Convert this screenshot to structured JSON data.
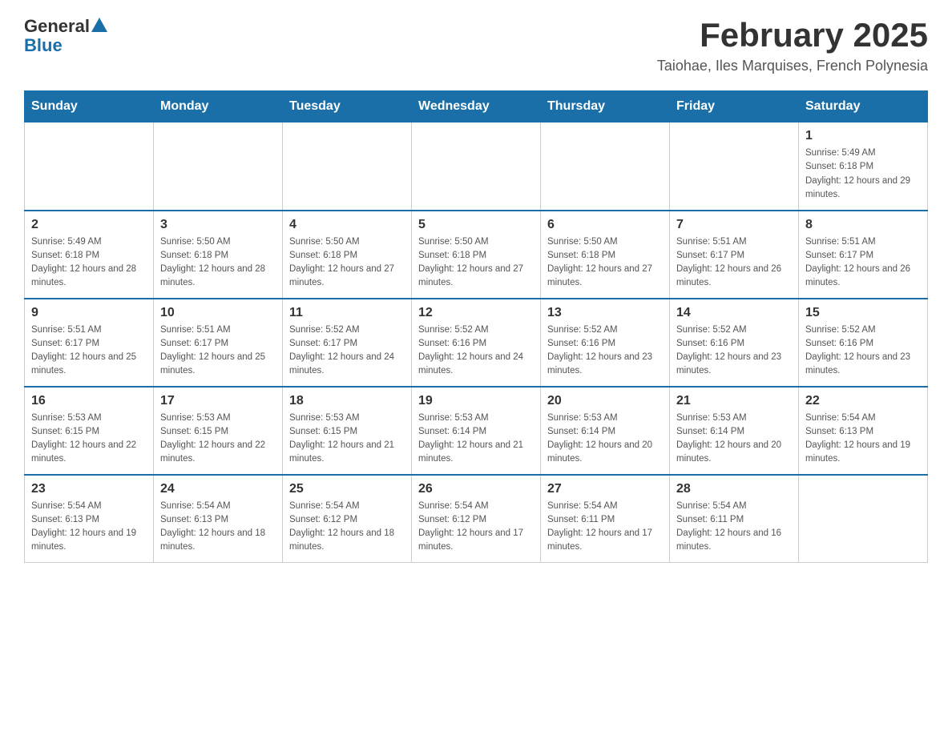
{
  "logo": {
    "general": "General",
    "blue": "Blue"
  },
  "title": "February 2025",
  "location": "Taiohae, Iles Marquises, French Polynesia",
  "days_of_week": [
    "Sunday",
    "Monday",
    "Tuesday",
    "Wednesday",
    "Thursday",
    "Friday",
    "Saturday"
  ],
  "weeks": [
    [
      {
        "day": "",
        "sunrise": "",
        "sunset": "",
        "daylight": ""
      },
      {
        "day": "",
        "sunrise": "",
        "sunset": "",
        "daylight": ""
      },
      {
        "day": "",
        "sunrise": "",
        "sunset": "",
        "daylight": ""
      },
      {
        "day": "",
        "sunrise": "",
        "sunset": "",
        "daylight": ""
      },
      {
        "day": "",
        "sunrise": "",
        "sunset": "",
        "daylight": ""
      },
      {
        "day": "",
        "sunrise": "",
        "sunset": "",
        "daylight": ""
      },
      {
        "day": "1",
        "sunrise": "Sunrise: 5:49 AM",
        "sunset": "Sunset: 6:18 PM",
        "daylight": "Daylight: 12 hours and 29 minutes."
      }
    ],
    [
      {
        "day": "2",
        "sunrise": "Sunrise: 5:49 AM",
        "sunset": "Sunset: 6:18 PM",
        "daylight": "Daylight: 12 hours and 28 minutes."
      },
      {
        "day": "3",
        "sunrise": "Sunrise: 5:50 AM",
        "sunset": "Sunset: 6:18 PM",
        "daylight": "Daylight: 12 hours and 28 minutes."
      },
      {
        "day": "4",
        "sunrise": "Sunrise: 5:50 AM",
        "sunset": "Sunset: 6:18 PM",
        "daylight": "Daylight: 12 hours and 27 minutes."
      },
      {
        "day": "5",
        "sunrise": "Sunrise: 5:50 AM",
        "sunset": "Sunset: 6:18 PM",
        "daylight": "Daylight: 12 hours and 27 minutes."
      },
      {
        "day": "6",
        "sunrise": "Sunrise: 5:50 AM",
        "sunset": "Sunset: 6:18 PM",
        "daylight": "Daylight: 12 hours and 27 minutes."
      },
      {
        "day": "7",
        "sunrise": "Sunrise: 5:51 AM",
        "sunset": "Sunset: 6:17 PM",
        "daylight": "Daylight: 12 hours and 26 minutes."
      },
      {
        "day": "8",
        "sunrise": "Sunrise: 5:51 AM",
        "sunset": "Sunset: 6:17 PM",
        "daylight": "Daylight: 12 hours and 26 minutes."
      }
    ],
    [
      {
        "day": "9",
        "sunrise": "Sunrise: 5:51 AM",
        "sunset": "Sunset: 6:17 PM",
        "daylight": "Daylight: 12 hours and 25 minutes."
      },
      {
        "day": "10",
        "sunrise": "Sunrise: 5:51 AM",
        "sunset": "Sunset: 6:17 PM",
        "daylight": "Daylight: 12 hours and 25 minutes."
      },
      {
        "day": "11",
        "sunrise": "Sunrise: 5:52 AM",
        "sunset": "Sunset: 6:17 PM",
        "daylight": "Daylight: 12 hours and 24 minutes."
      },
      {
        "day": "12",
        "sunrise": "Sunrise: 5:52 AM",
        "sunset": "Sunset: 6:16 PM",
        "daylight": "Daylight: 12 hours and 24 minutes."
      },
      {
        "day": "13",
        "sunrise": "Sunrise: 5:52 AM",
        "sunset": "Sunset: 6:16 PM",
        "daylight": "Daylight: 12 hours and 23 minutes."
      },
      {
        "day": "14",
        "sunrise": "Sunrise: 5:52 AM",
        "sunset": "Sunset: 6:16 PM",
        "daylight": "Daylight: 12 hours and 23 minutes."
      },
      {
        "day": "15",
        "sunrise": "Sunrise: 5:52 AM",
        "sunset": "Sunset: 6:16 PM",
        "daylight": "Daylight: 12 hours and 23 minutes."
      }
    ],
    [
      {
        "day": "16",
        "sunrise": "Sunrise: 5:53 AM",
        "sunset": "Sunset: 6:15 PM",
        "daylight": "Daylight: 12 hours and 22 minutes."
      },
      {
        "day": "17",
        "sunrise": "Sunrise: 5:53 AM",
        "sunset": "Sunset: 6:15 PM",
        "daylight": "Daylight: 12 hours and 22 minutes."
      },
      {
        "day": "18",
        "sunrise": "Sunrise: 5:53 AM",
        "sunset": "Sunset: 6:15 PM",
        "daylight": "Daylight: 12 hours and 21 minutes."
      },
      {
        "day": "19",
        "sunrise": "Sunrise: 5:53 AM",
        "sunset": "Sunset: 6:14 PM",
        "daylight": "Daylight: 12 hours and 21 minutes."
      },
      {
        "day": "20",
        "sunrise": "Sunrise: 5:53 AM",
        "sunset": "Sunset: 6:14 PM",
        "daylight": "Daylight: 12 hours and 20 minutes."
      },
      {
        "day": "21",
        "sunrise": "Sunrise: 5:53 AM",
        "sunset": "Sunset: 6:14 PM",
        "daylight": "Daylight: 12 hours and 20 minutes."
      },
      {
        "day": "22",
        "sunrise": "Sunrise: 5:54 AM",
        "sunset": "Sunset: 6:13 PM",
        "daylight": "Daylight: 12 hours and 19 minutes."
      }
    ],
    [
      {
        "day": "23",
        "sunrise": "Sunrise: 5:54 AM",
        "sunset": "Sunset: 6:13 PM",
        "daylight": "Daylight: 12 hours and 19 minutes."
      },
      {
        "day": "24",
        "sunrise": "Sunrise: 5:54 AM",
        "sunset": "Sunset: 6:13 PM",
        "daylight": "Daylight: 12 hours and 18 minutes."
      },
      {
        "day": "25",
        "sunrise": "Sunrise: 5:54 AM",
        "sunset": "Sunset: 6:12 PM",
        "daylight": "Daylight: 12 hours and 18 minutes."
      },
      {
        "day": "26",
        "sunrise": "Sunrise: 5:54 AM",
        "sunset": "Sunset: 6:12 PM",
        "daylight": "Daylight: 12 hours and 17 minutes."
      },
      {
        "day": "27",
        "sunrise": "Sunrise: 5:54 AM",
        "sunset": "Sunset: 6:11 PM",
        "daylight": "Daylight: 12 hours and 17 minutes."
      },
      {
        "day": "28",
        "sunrise": "Sunrise: 5:54 AM",
        "sunset": "Sunset: 6:11 PM",
        "daylight": "Daylight: 12 hours and 16 minutes."
      },
      {
        "day": "",
        "sunrise": "",
        "sunset": "",
        "daylight": ""
      }
    ]
  ]
}
